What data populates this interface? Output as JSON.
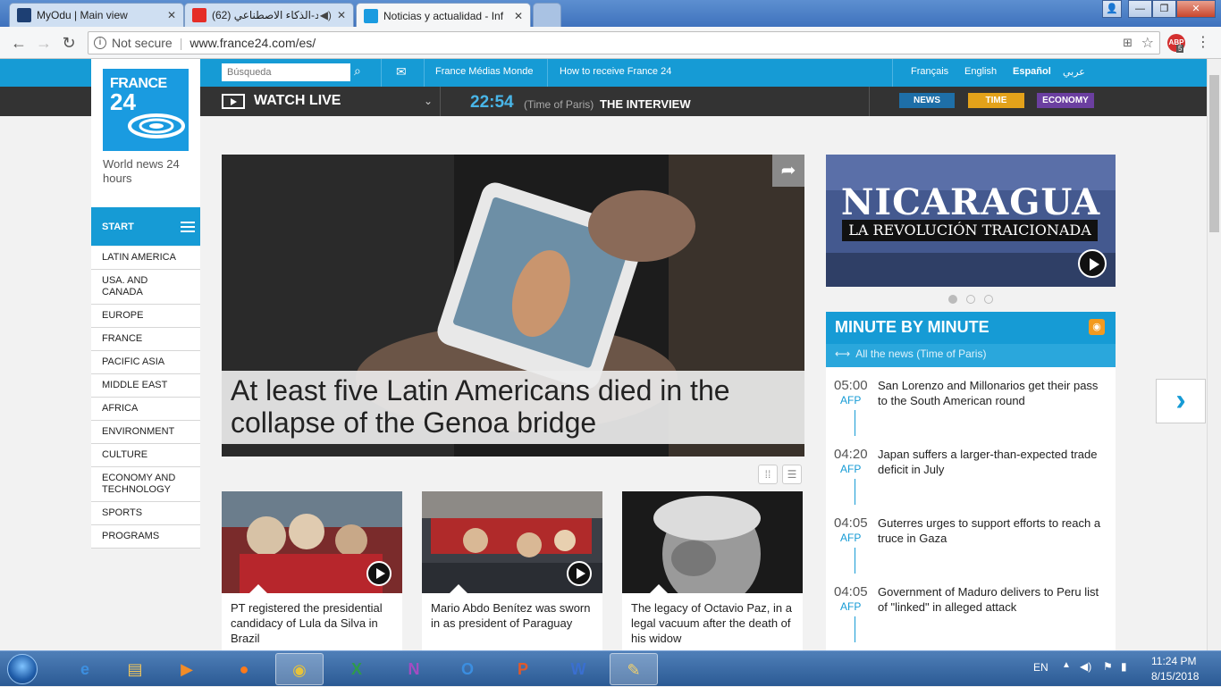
{
  "browser": {
    "tabs": [
      {
        "title": "MyOdu | Main view",
        "active": false
      },
      {
        "title": "(62) الحصاد-الذكاء الاصطناعي",
        "active": false
      },
      {
        "title": "Noticias y actualidad - Inf",
        "active": true
      }
    ],
    "security": "Not secure",
    "url": "www.france24.com/es/",
    "extension_badge": "5"
  },
  "header": {
    "logo_line1": "FRANCE",
    "logo_line2": "24",
    "tagline": "World news 24 hours",
    "search_placeholder": "Búsqueda",
    "links": [
      "France Médias Monde",
      "How to receive France 24"
    ],
    "languages": [
      "Français",
      "English",
      "Español",
      "عربي"
    ],
    "active_language": "Español"
  },
  "live": {
    "watch_label": "WATCH LIVE",
    "time": "22:54",
    "tz": "(Time of Paris)",
    "show": "THE INTERVIEW",
    "pills": [
      {
        "label": "NEWS",
        "color": "#1e6fa8"
      },
      {
        "label": "TIME",
        "color": "#e3a21a"
      },
      {
        "label": "ECONOMY",
        "color": "#6b3fa0"
      }
    ]
  },
  "sidebar": {
    "start_label": "START",
    "items": [
      "LATIN AMERICA",
      "USA. AND CANADA",
      "EUROPE",
      "FRANCE",
      "PACIFIC ASIA",
      "MIDDLE EAST",
      "AFRICA",
      "ENVIRONMENT",
      "CULTURE",
      "ECONOMY AND TECHNOLOGY",
      "SPORTS",
      "PROGRAMS"
    ]
  },
  "hero": {
    "headline": "At least five Latin Americans died in the collapse of the Genoa bridge"
  },
  "cards": [
    {
      "text": "PT registered the presidential candidacy of Lula da Silva in Brazil",
      "has_video": true
    },
    {
      "text": "Mario Abdo Benítez was sworn in as president of Paraguay",
      "has_video": true
    },
    {
      "text": "The legacy of Octavio Paz, in a legal vacuum after the death of his widow",
      "has_video": false
    }
  ],
  "banner": {
    "title": "NICARAGUA",
    "subtitle": "LA REVOLUCIÓN TRAICIONADA"
  },
  "minute": {
    "title": "MINUTE BY MINUTE",
    "all_link": "All the news (Time of Paris)",
    "items": [
      {
        "time": "05:00",
        "source": "AFP",
        "headline": "San Lorenzo and Millonarios get their pass to the South American round"
      },
      {
        "time": "04:20",
        "source": "AFP",
        "headline": "Japan suffers a larger-than-expected trade deficit in July"
      },
      {
        "time": "04:05",
        "source": "AFP",
        "headline": "Guterres urges to support efforts to reach a truce in Gaza"
      },
      {
        "time": "04:05",
        "source": "AFP",
        "headline": "Government of Maduro delivers to Peru list of \"linked\" in alleged attack"
      }
    ]
  },
  "taskbar": {
    "lang": "EN",
    "time": "11:24 PM",
    "date": "8/15/2018"
  }
}
